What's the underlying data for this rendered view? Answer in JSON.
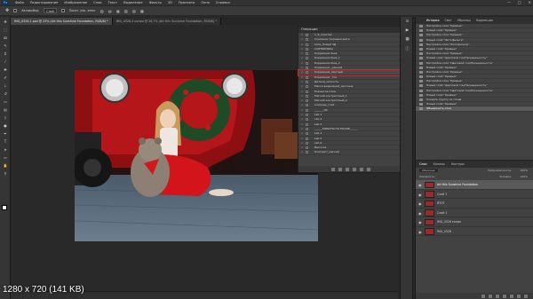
{
  "app": {
    "logo": "Ps",
    "menu": [
      "Файл",
      "Редактирование",
      "Изображение",
      "Слои",
      "Текст",
      "Выделение",
      "Фильтр",
      "3D",
      "Просмотр",
      "Окно",
      "Справка"
    ],
    "window_controls": [
      "—",
      "□",
      "✕"
    ]
  },
  "options": {
    "auto_select_label": "Автовыбор:",
    "auto_select_value": "Слой",
    "show_controls": "Показ. упр. элем."
  },
  "tabs": [
    {
      "label": "IMG_0326-1.psd @ 25% (Art this Sunshine Foundation, RGB/8) *"
    },
    {
      "label": "IMG_0326-4 копия @ 28,7% (Art this Sunshine Foundation, RGB/8) *"
    }
  ],
  "toolbar_icons": [
    "move-icon",
    "marquee-icon",
    "lasso-icon",
    "quick-select-icon",
    "crop-icon",
    "eyedropper-icon",
    "healing-icon",
    "brush-icon",
    "stamp-icon",
    "history-brush-icon",
    "eraser-icon",
    "gradient-icon",
    "blur-icon",
    "dodge-icon",
    "pen-icon",
    "type-icon",
    "path-select-icon",
    "shape-icon",
    "hand-icon",
    "zoom-icon"
  ],
  "status_overlay": "1280 x 720 (141 KB)",
  "actions_panel": {
    "title": "Операции",
    "rows": [
      {
        "label": "1_Я_пластик",
        "checked": true
      },
      {
        "label": "Усиление тасредки шаги",
        "checked": true
      },
      {
        "label": "Sims_Новый ЧД",
        "checked": true
      },
      {
        "label": "СОРТИРОВКА",
        "checked": true
      },
      {
        "label": "Коррекция база",
        "checked": true
      },
      {
        "label": "Коррекция база_1",
        "checked": true
      },
      {
        "label": "Коррекция база_2",
        "checked": true
      },
      {
        "label": "Коррекция _ранний",
        "checked": true
      },
      {
        "label": "Коррекция_светлый",
        "checked": true,
        "highlight": true
      },
      {
        "label": "Коррекция _тон",
        "checked": true
      },
      {
        "label": "Детали_четкость",
        "checked": true
      },
      {
        "label": "Маска выделения_местные",
        "checked": true
      },
      {
        "label": "Розмытие плов",
        "checked": true
      },
      {
        "label": "Мягкий контрастный_1",
        "checked": true
      },
      {
        "label": "Мягкий контрастный_2",
        "checked": true
      },
      {
        "label": "Слияние_слой",
        "checked": true
      },
      {
        "label": "_______АБ",
        "checked": true
      },
      {
        "label": "Lab 1",
        "checked": true
      },
      {
        "label": "Lab 2",
        "checked": true
      },
      {
        "label": "Lab 3",
        "checked": true
      },
      {
        "label": "______МИКСТЫ ПО МАСКЕ______",
        "checked": true
      },
      {
        "label": "Lab 4",
        "checked": true
      },
      {
        "label": "Lab 5",
        "checked": true
      },
      {
        "label": "Lab 6",
        "checked": true
      },
      {
        "label": "Выкочок",
        "checked": true
      },
      {
        "label": "Контраст_мягкий",
        "checked": true
      }
    ]
  },
  "history_panel": {
    "tabs": [
      "История",
      "Свет",
      "Образцы",
      "Коррекция"
    ],
    "rows": [
      "Настройка слоя \"Кривые\"",
      "Новый слой \"Кривые\"",
      "Настройка слоя \"Кривые\"",
      "Новый слой \"Фотофильтр\"",
      "Настройка слоя \"Фотофильтр\"",
      "Новый слой \"Кривые\"",
      "Настройка слоя \"Кривые\"",
      "Новый слой \"Цветовой тон/Насыщенность\"",
      "Настройка слоя \"Цветовой тон/Насыщенность\"",
      "Новый слой \"Кривые\"",
      "Настройка слоя \"Кривые\"",
      "Новый слой \"Кривые\"",
      "Настройка слоя \"Кривые\"",
      "Новый слой \"Цветовой тон/Насыщенность\"",
      "Настройка слоя \"Цветовой тон/Насыщенность\"",
      "Новый слой \"Кривые\"",
      "Создать группу из слоев",
      "Новый слой \"Кривые\"",
      "Объединить слои"
    ],
    "selected_index": 18
  },
  "layers_panel": {
    "tabs": [
      "Слои",
      "Каналы",
      "Контуры"
    ],
    "active_tab": 0,
    "blend_mode": "Обычные",
    "opacity_label": "Непрозрачность:",
    "opacity_value": "100%",
    "lock_label": "Закрепить:",
    "fill_label": "Заливка:",
    "fill_value": "100%",
    "layers": [
      {
        "name": "Art this Sunshine Foundation",
        "selected": true
      },
      {
        "name": "Слой 1"
      },
      {
        "name": "ИТОГ"
      },
      {
        "name": "Слой 1"
      },
      {
        "name": "IMG_0326 копия"
      },
      {
        "name": "IMG_0326"
      }
    ]
  }
}
